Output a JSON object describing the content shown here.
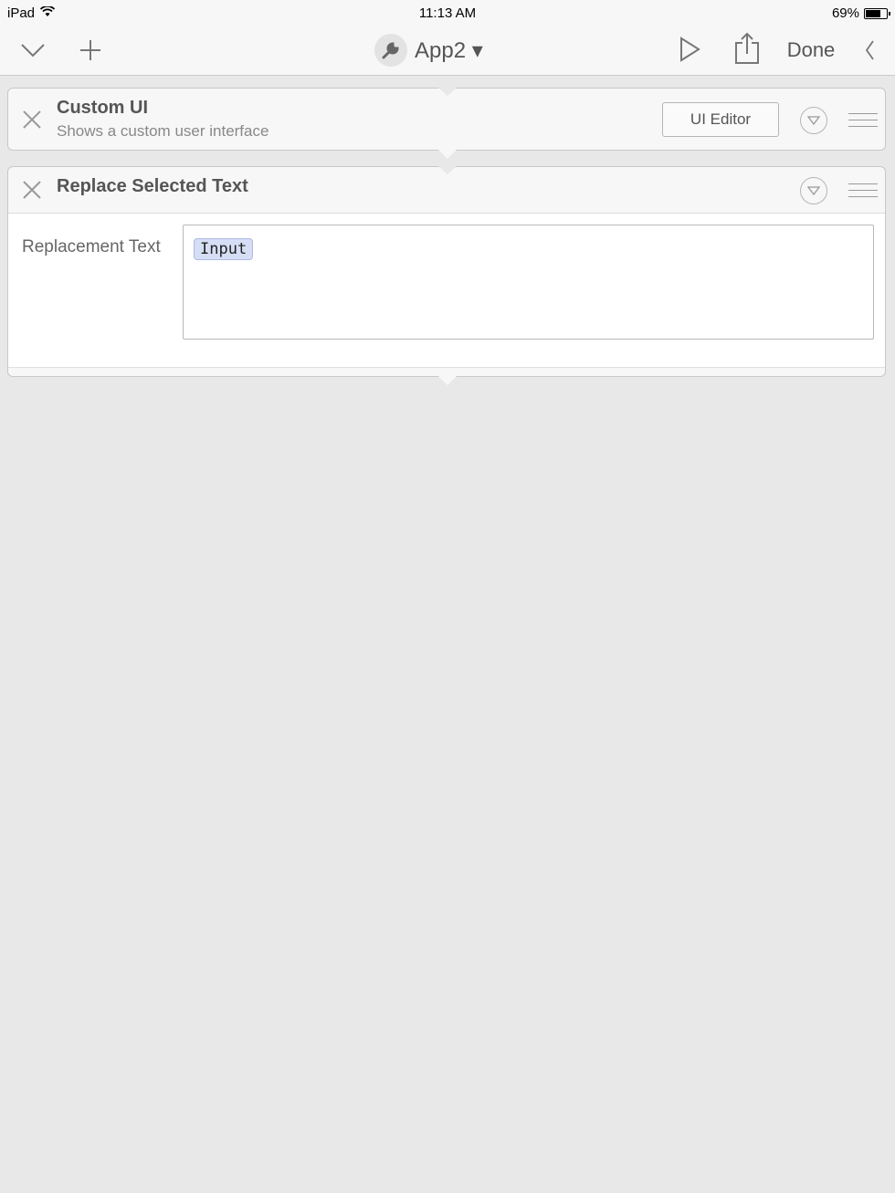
{
  "status_bar": {
    "device": "iPad",
    "time": "11:13 AM",
    "battery": "69%",
    "battery_level": 0.69
  },
  "toolbar": {
    "collapse_icon": "chevron-down-icon",
    "add_icon": "plus-icon",
    "workflow_icon": "wrench-icon",
    "workflow_title": "App2 ▾",
    "run_icon": "play-icon",
    "share_icon": "share-icon",
    "done_label": "Done",
    "back_icon": "chevron-left-icon"
  },
  "actions": [
    {
      "title": "Custom UI",
      "subtitle": "Shows a custom user interface",
      "button_label": "UI Editor"
    },
    {
      "title": "Replace Selected Text",
      "parameter_label": "Replacement Text",
      "parameter_token": "Input"
    }
  ],
  "colors": {
    "background": "#e8e8e8",
    "card": "#f7f7f7",
    "token_fill": "#d6def5"
  }
}
